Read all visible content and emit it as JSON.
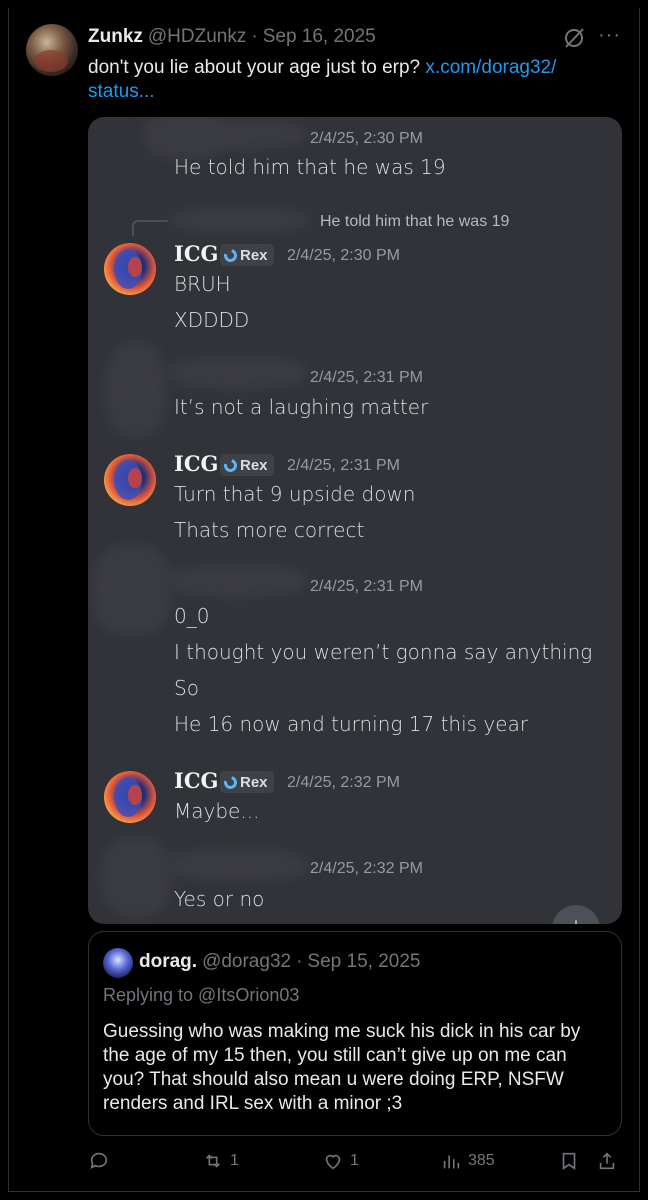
{
  "tweet": {
    "name": "Zunkz",
    "handle": "@HDZunkz",
    "separator": "·",
    "date": "Sep 16, 2025",
    "more_icon": "more-icon",
    "grok_icon": "grok-icon",
    "text": "don't you lie about your age just to erp? ",
    "link_line1": "x.com/dorag32/",
    "link_line2": "status..."
  },
  "discord": {
    "messages": [
      {
        "time": "2/4/25, 2:30 PM",
        "lines": [
          "He told him that he was 19"
        ]
      },
      {
        "reply_to": "He told him that he was 19"
      },
      {
        "name": "ICG",
        "tag": "Rex",
        "time": "2/4/25, 2:30 PM",
        "lines": [
          "BRUH",
          "XDDDD"
        ]
      },
      {
        "time": "2/4/25, 2:31 PM",
        "lines": [
          "It’s not a laughing matter"
        ]
      },
      {
        "name": "ICG",
        "tag": "Rex",
        "time": "2/4/25, 2:31 PM",
        "lines": [
          "Turn that 9 upside down",
          "Thats more correct"
        ]
      },
      {
        "time": "2/4/25, 2:31 PM",
        "lines": [
          "0_0",
          "I thought you weren’t gonna say anything",
          "So",
          "He 16 now and turning 17 this year"
        ]
      },
      {
        "name": "ICG",
        "tag": "Rex",
        "time": "2/4/25, 2:32 PM",
        "lines": [
          "Maybe..."
        ]
      },
      {
        "time": "2/4/25, 2:32 PM",
        "lines": [
          "Yes or no"
        ]
      }
    ]
  },
  "quote": {
    "name": "dorag.",
    "handle": "@dorag32",
    "separator": "·",
    "date": "Sep 15, 2025",
    "replying": "Replying to @ItsOrion03",
    "text": "Guessing who was making me suck his dick in his car by the age of my 15 then, you still can’t give up on me can you? That should also mean u were doing ERP, NSFW renders and IRL sex with a minor ;3"
  },
  "actions": {
    "reply_count": "",
    "repost_count": "1",
    "like_count": "1",
    "views_count": "385"
  }
}
